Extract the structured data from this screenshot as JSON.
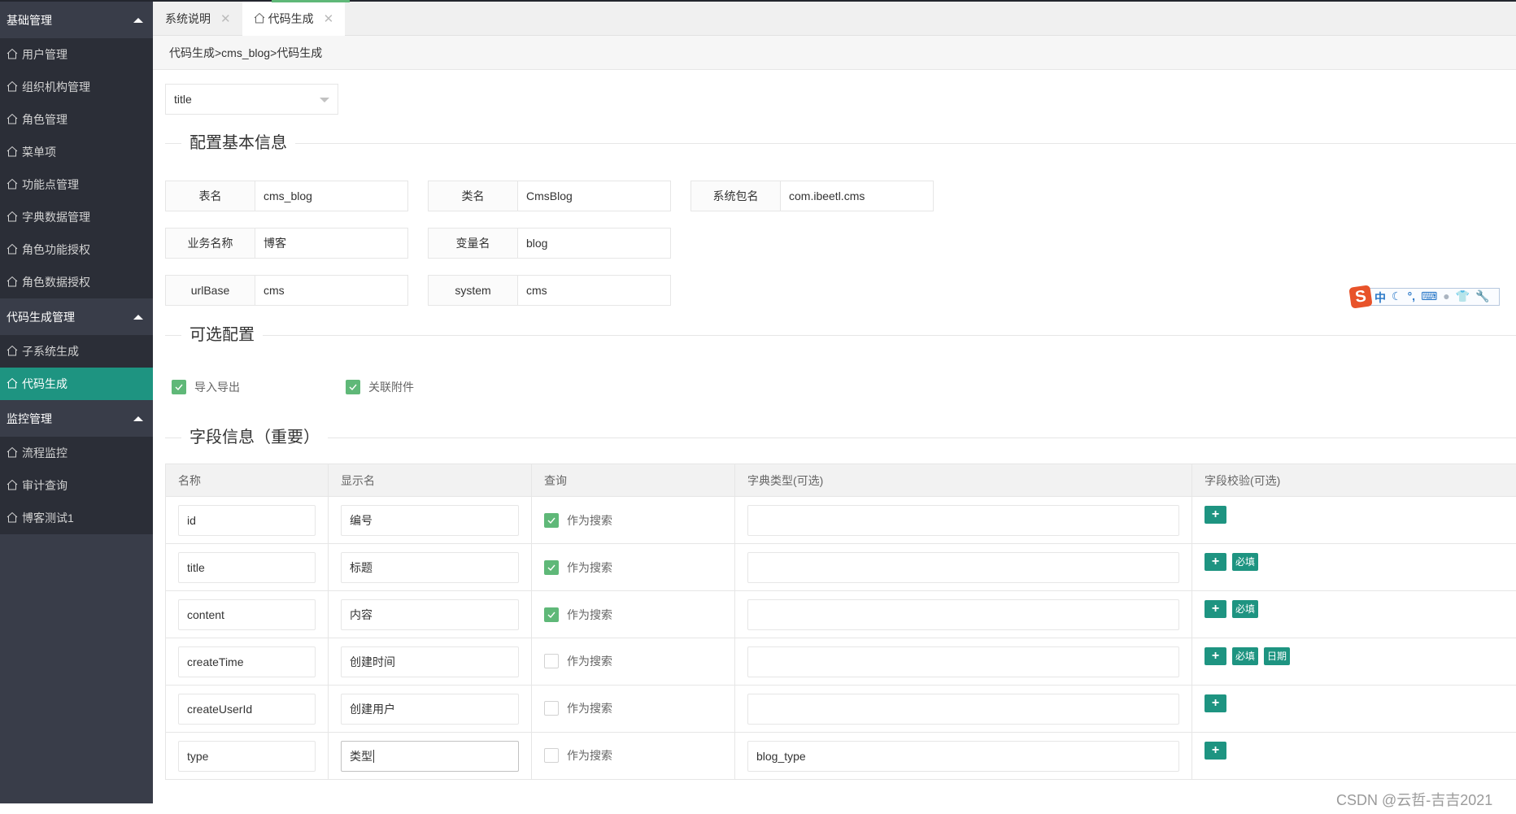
{
  "sidebar": {
    "groups": [
      {
        "title": "基础管理",
        "items": [
          "用户管理",
          "组织机构管理",
          "角色管理",
          "菜单项",
          "功能点管理",
          "字典数据管理",
          "角色功能授权",
          "角色数据授权"
        ]
      },
      {
        "title": "代码生成管理",
        "items": [
          "子系统生成",
          "代码生成"
        ]
      },
      {
        "title": "监控管理",
        "items": [
          "流程监控",
          "审计查询",
          "博客测试1"
        ]
      }
    ],
    "active_item": "代码生成"
  },
  "tabs": [
    {
      "label": "系统说明",
      "active": false
    },
    {
      "label": "代码生成",
      "active": true
    }
  ],
  "colors": {
    "accent": "#1e9481",
    "checkbox": "#5fb878",
    "sidebar_bg": "#2b2e37",
    "sidebar_group": "#393d49"
  },
  "breadcrumb": "代码生成>cms_blog>代码生成",
  "select": {
    "value": "title"
  },
  "basic": {
    "title": "配置基本信息",
    "fields": [
      {
        "label": "表名",
        "value": "cms_blog"
      },
      {
        "label": "类名",
        "value": "CmsBlog"
      },
      {
        "label": "系统包名",
        "value": "com.ibeetl.cms"
      },
      {
        "label": "业务名称",
        "value": "博客"
      },
      {
        "label": "变量名",
        "value": "blog"
      },
      {
        "label": "urlBase",
        "value": "cms"
      },
      {
        "label": "system",
        "value": "cms"
      }
    ]
  },
  "optional": {
    "title": "可选配置",
    "options": [
      {
        "label": "导入导出",
        "checked": true
      },
      {
        "label": "关联附件",
        "checked": true
      }
    ]
  },
  "fields_section": {
    "title": "字段信息（重要）",
    "columns": [
      "名称",
      "显示名",
      "查询",
      "字典类型(可选)",
      "字段校验(可选)"
    ],
    "search_label": "作为搜索",
    "rows": [
      {
        "name": "id",
        "display": "编号",
        "search": true,
        "dict": "",
        "validators": []
      },
      {
        "name": "title",
        "display": "标题",
        "search": true,
        "dict": "",
        "validators": [
          "必填"
        ]
      },
      {
        "name": "content",
        "display": "内容",
        "search": true,
        "dict": "",
        "validators": [
          "必填"
        ]
      },
      {
        "name": "createTime",
        "display": "创建时间",
        "search": false,
        "dict": "",
        "validators": [
          "必填",
          "日期"
        ]
      },
      {
        "name": "createUserId",
        "display": "创建用户",
        "search": false,
        "dict": "",
        "validators": []
      },
      {
        "name": "type",
        "display": "类型",
        "search": false,
        "dict": "blog_type",
        "validators": []
      }
    ],
    "add_validator_label": "+"
  },
  "ime": {
    "logo": "S",
    "icons": [
      "中",
      "moon",
      "°,",
      "keyboard",
      "user",
      "shirt",
      "wrench"
    ]
  },
  "watermark": "CSDN @云哲-吉吉2021"
}
